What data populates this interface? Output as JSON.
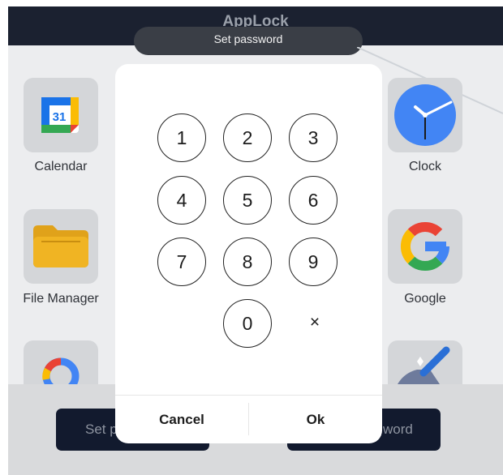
{
  "header": {
    "title": "AppLock",
    "toast": "Set password"
  },
  "apps": {
    "calendar": {
      "label": "Calendar",
      "badge": "31"
    },
    "clock": {
      "label": "Clock"
    },
    "file_manager": {
      "label": "File Manager"
    },
    "google": {
      "label": "Google"
    }
  },
  "bottom_buttons": {
    "left_label": "Set p",
    "right_label": "word"
  },
  "keypad": {
    "keys": [
      "1",
      "2",
      "3",
      "4",
      "5",
      "6",
      "7",
      "8",
      "9",
      "0"
    ],
    "delete": "×"
  },
  "dialog": {
    "cancel_label": "Cancel",
    "ok_label": "Ok"
  },
  "colors": {
    "header_bg": "#1b2130",
    "overlay": "#ecedef",
    "button_dark": "#121a2e"
  }
}
